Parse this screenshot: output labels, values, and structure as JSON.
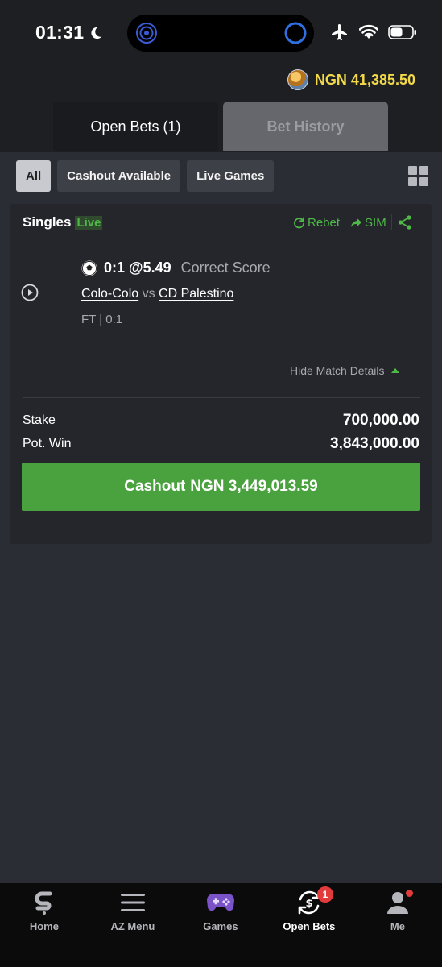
{
  "status_bar": {
    "time": "01:31",
    "moon_icon": "crescent-moon-icon"
  },
  "balance": {
    "amount": "NGN 41,385.50",
    "icon": "balance-coin-icon",
    "color": "#f2d94a"
  },
  "tabs": [
    {
      "label": "Open Bets (1)",
      "active": true
    },
    {
      "label": "Bet History",
      "active": false
    }
  ],
  "filters": [
    {
      "label": "All",
      "active": true
    },
    {
      "label": "Cashout Available",
      "active": false
    },
    {
      "label": "Live Games",
      "active": false
    }
  ],
  "bet": {
    "type": "Singles",
    "live_label": "Live",
    "actions": {
      "rebet": "Rebet",
      "sim": "SIM"
    },
    "pick": "0:1 @5.49",
    "market": "Correct Score",
    "home_team": "Colo-Colo",
    "vs": "vs",
    "away_team": "CD Palestino",
    "status": "FT | 0:1",
    "hide_details": "Hide Match Details",
    "stake_label": "Stake",
    "stake_value": "700,000.00",
    "potwin_label": "Pot. Win",
    "potwin_value": "3,843,000.00",
    "cashout_prefix": "Cashout",
    "cashout_amount": "NGN 3,449,013.59"
  },
  "colors": {
    "accent_green": "#4aa23f",
    "live_green": "#4fb947",
    "badge_red": "#e23b3b"
  },
  "bottom_nav": [
    {
      "label": "Home",
      "icon": "sportybet-logo-icon"
    },
    {
      "label": "AZ Menu",
      "icon": "hamburger-menu-icon"
    },
    {
      "label": "Games",
      "icon": "gamepad-icon"
    },
    {
      "label": "Open Bets",
      "icon": "open-bets-icon",
      "badge": "1",
      "active": true
    },
    {
      "label": "Me",
      "icon": "user-icon"
    }
  ]
}
